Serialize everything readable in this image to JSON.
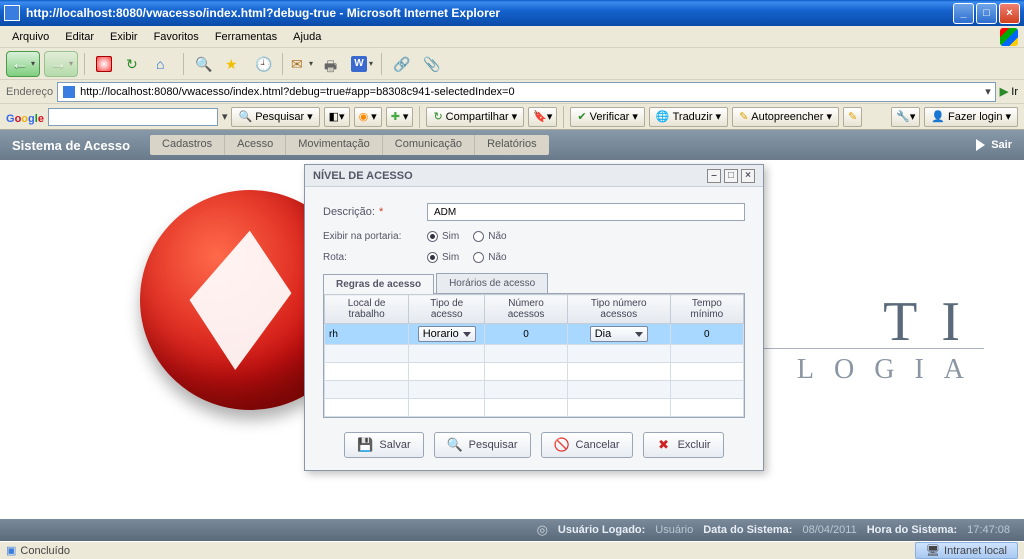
{
  "window": {
    "title": "http://localhost:8080/vwacesso/index.html?debug-true - Microsoft Internet Explorer",
    "min": "_",
    "max": "□",
    "close": "×"
  },
  "menubar": [
    "Arquivo",
    "Editar",
    "Exibir",
    "Favoritos",
    "Ferramentas",
    "Ajuda"
  ],
  "address": {
    "label": "Endereço",
    "url": "http://localhost:8080/vwacesso/index.html?debug=true#app=b8308c941-selectedIndex=0",
    "go": "Ir"
  },
  "google": {
    "search_btn": "Pesquisar",
    "share_btn": "Compartilhar",
    "verify_btn": "Verificar",
    "translate_btn": "Traduzir",
    "autofill_btn": "Autopreencher",
    "login_btn": "Fazer login"
  },
  "app": {
    "title": "Sistema de Acesso",
    "menu": [
      "Cadastros",
      "Acesso",
      "Movimentação",
      "Comunicação",
      "Relatórios"
    ],
    "sair": "Sair"
  },
  "modal": {
    "title": "NÍVEL DE ACESSO",
    "fields": {
      "descricao_label": "Descrição:",
      "descricao_value": "ADM",
      "exibir_label": "Exibir na portaria:",
      "rota_label": "Rota:",
      "sim": "Sim",
      "nao": "Não"
    },
    "tabs": {
      "regras": "Regras de acesso",
      "horarios": "Horários de acesso"
    },
    "grid": {
      "headers": [
        "Local de trabalho",
        "Tipo de acesso",
        "Número acessos",
        "Tipo número acessos",
        "Tempo mínimo"
      ],
      "row": {
        "local": "rh",
        "tipo": "Horario",
        "numero": "0",
        "tiponum": "Dia",
        "tempo": "0"
      }
    },
    "buttons": {
      "salvar": "Salvar",
      "pesquisar": "Pesquisar",
      "cancelar": "Cancelar",
      "excluir": "Excluir"
    }
  },
  "status": {
    "usuario_lbl": "Usuário Logado:",
    "usuario_val": "Usuário",
    "data_lbl": "Data do Sistema:",
    "data_val": "08/04/2011",
    "hora_lbl": "Hora do Sistema:",
    "hora_val": "17:47:08"
  },
  "iestatus": {
    "done": "Concluído",
    "zone": "Intranet local"
  },
  "bg": {
    "big": "TI",
    "small": "LOGIA"
  }
}
